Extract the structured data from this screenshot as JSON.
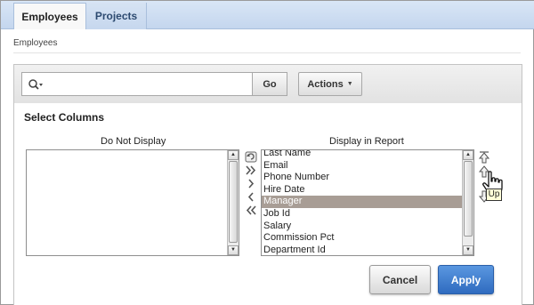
{
  "tabs": [
    {
      "label": "Employees",
      "active": true
    },
    {
      "label": "Projects",
      "active": false
    }
  ],
  "breadcrumb": "Employees",
  "search": {
    "value": "",
    "placeholder": "",
    "icon": "search-icon",
    "go_label": "Go",
    "actions_label": "Actions"
  },
  "select_columns": {
    "title": "Select Columns",
    "do_not_display": {
      "heading": "Do Not Display",
      "items": []
    },
    "display_in_report": {
      "heading": "Display in Report",
      "items": [
        "Last Name",
        "Email",
        "Phone Number",
        "Hire Date",
        "Manager",
        "Job Id",
        "Salary",
        "Commission Pct",
        "Department Id"
      ],
      "selected": "Manager"
    },
    "transfer_icons": [
      "move-all-right-icon",
      "move-right-icon",
      "move-left-icon",
      "move-all-left-icon",
      "reset-icon"
    ],
    "order_icons": [
      "move-top-icon",
      "move-up-icon",
      "move-down-icon"
    ],
    "tooltip": "Up"
  },
  "buttons": {
    "cancel": "Cancel",
    "apply": "Apply"
  },
  "colors": {
    "apply_button": "#2f6bbf",
    "selected_row": "#a89d95",
    "tab_bar": "#c4d6ee"
  }
}
